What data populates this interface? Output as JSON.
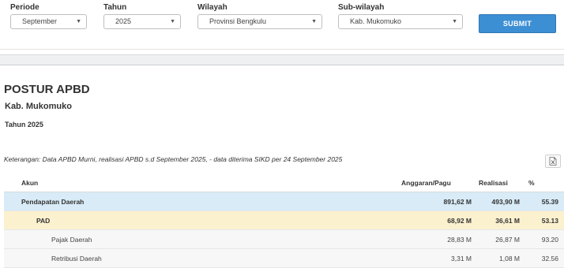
{
  "filters": {
    "periode": {
      "label": "Periode",
      "value": "September"
    },
    "tahun": {
      "label": "Tahun",
      "value": "2025"
    },
    "wilayah": {
      "label": "Wilayah",
      "value": "Provinsi Bengkulu"
    },
    "subwilayah": {
      "label": "Sub-wilayah",
      "value": "Kab. Mukomuko"
    },
    "submit_label": "SUBMIT"
  },
  "report": {
    "title": "POSTUR APBD",
    "region": "Kab. Mukomuko",
    "year": "Tahun 2025",
    "note": "Keterangan: Data APBD Murni, realisasi APBD s.d September 2025, - data diterima SIKD per 24 September 2025"
  },
  "table": {
    "headers": {
      "akun": "Akun",
      "anggaran": "Anggaran/Pagu",
      "realisasi": "Realisasi",
      "persen": "%"
    },
    "rows": [
      {
        "akun": "Pendapatan Daerah",
        "anggaran": "891,62 M",
        "realisasi": "493,90 M",
        "persen": "55.39",
        "level": 0
      },
      {
        "akun": "PAD",
        "anggaran": "68,92 M",
        "realisasi": "36,61 M",
        "persen": "53.13",
        "level": 1
      },
      {
        "akun": "Pajak Daerah",
        "anggaran": "28,83 M",
        "realisasi": "26,87 M",
        "persen": "93.20",
        "level": 2
      },
      {
        "akun": "Retribusi Daerah",
        "anggaran": "3,31 M",
        "realisasi": "1,08 M",
        "persen": "32.56",
        "level": 2
      }
    ]
  },
  "icons": {
    "export": "excel-export-icon",
    "caret": "chevron-down-icon"
  },
  "colors": {
    "submit": "#3d8fd4",
    "row_level0": "#d8ebf7",
    "row_level1": "#fcf1cf",
    "row_level2": "#f7f7f7"
  }
}
